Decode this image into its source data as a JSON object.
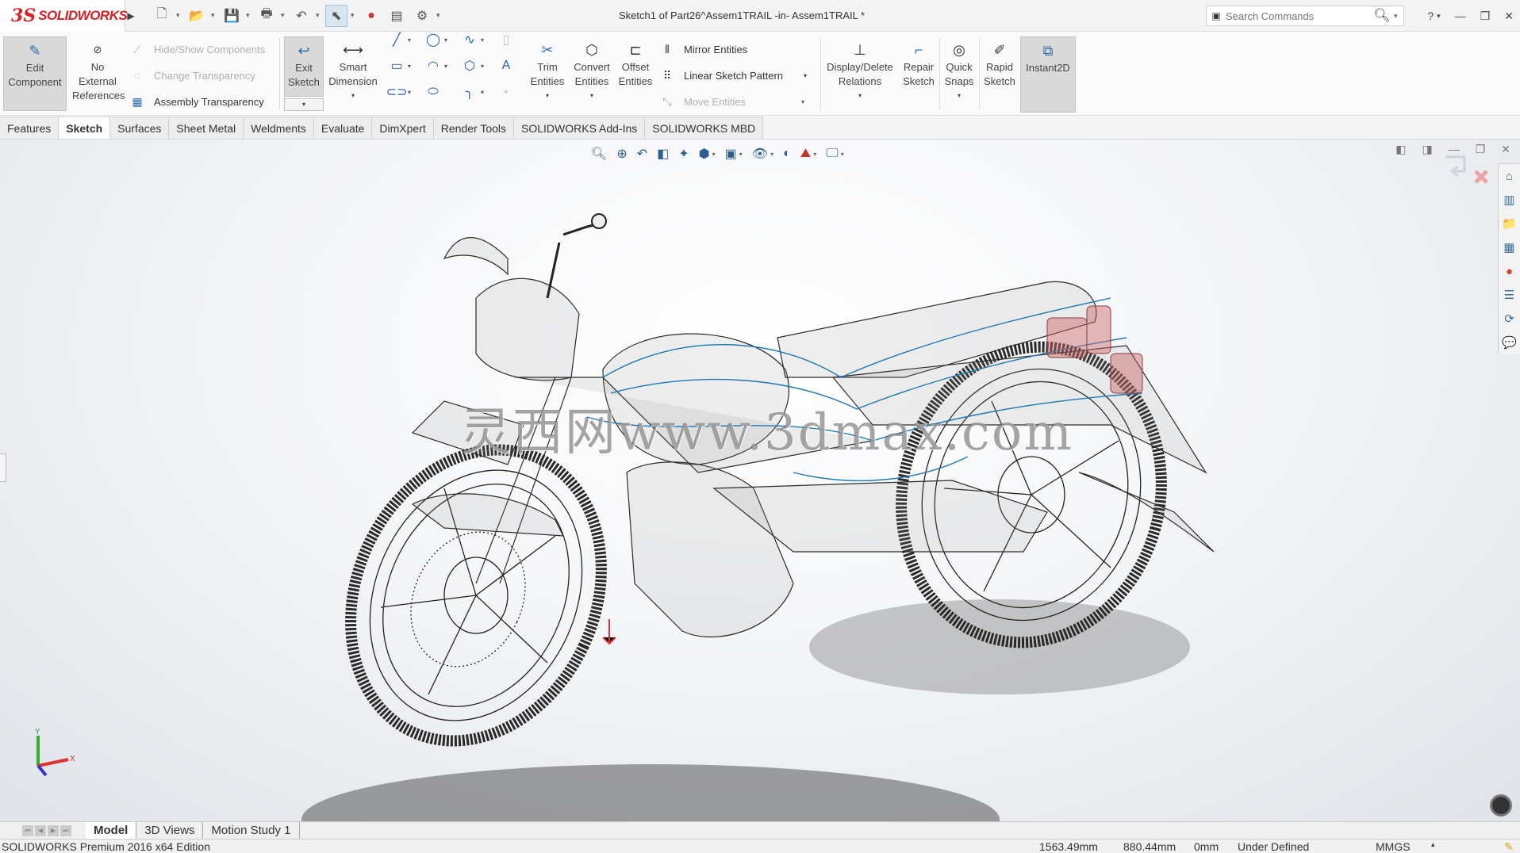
{
  "app": {
    "logo_ds": "3S",
    "logo_name": "SOLIDWORKS",
    "document_title": "Sketch1 of Part26^Assem1TRAIL -in- Assem1TRAIL *",
    "search_placeholder": "Search Commands",
    "help_label": "?"
  },
  "ribbon": {
    "edit_component": "Edit Component",
    "no_external_references": "No External References",
    "hide_show_components": "Hide/Show Components",
    "change_transparency": "Change Transparency",
    "assembly_transparency": "Assembly Transparency",
    "exit_sketch": "Exit Sketch",
    "smart_dimension": "Smart Dimension",
    "trim_entities": "Trim Entities",
    "convert_entities": "Convert Entities",
    "offset_entities": "Offset Entities",
    "mirror_entities": "Mirror Entities",
    "linear_sketch_pattern": "Linear Sketch Pattern",
    "move_entities": "Move Entities",
    "display_delete_relations": "Display/Delete Relations",
    "repair_sketch": "Repair Sketch",
    "quick_snaps": "Quick Snaps",
    "rapid_sketch": "Rapid Sketch",
    "instant2d": "Instant2D"
  },
  "tabs": [
    {
      "label": "Features"
    },
    {
      "label": "Sketch",
      "active": true
    },
    {
      "label": "Surfaces"
    },
    {
      "label": "Sheet Metal"
    },
    {
      "label": "Weldments"
    },
    {
      "label": "Evaluate"
    },
    {
      "label": "DimXpert"
    },
    {
      "label": "Render Tools"
    },
    {
      "label": "SOLIDWORKS Add-Ins"
    },
    {
      "label": "SOLIDWORKS MBD"
    }
  ],
  "viewport": {
    "watermark": "灵西网www.3dmax.com",
    "triad_y": "Y",
    "triad_x": "X"
  },
  "bottom_tabs": [
    {
      "label": "Model",
      "active": true
    },
    {
      "label": "3D Views"
    },
    {
      "label": "Motion Study 1"
    }
  ],
  "status": {
    "edition": "SOLIDWORKS Premium 2016 x64 Edition",
    "x_coord": "1563.49mm",
    "y_coord": "880.44mm",
    "z_coord": "0mm",
    "sketch_state": "Under Defined",
    "units": "MMGS"
  },
  "colors": {
    "brand": "#d42127",
    "sketch_blue": "#1f77b4",
    "pressed": "#d9d9d9"
  }
}
